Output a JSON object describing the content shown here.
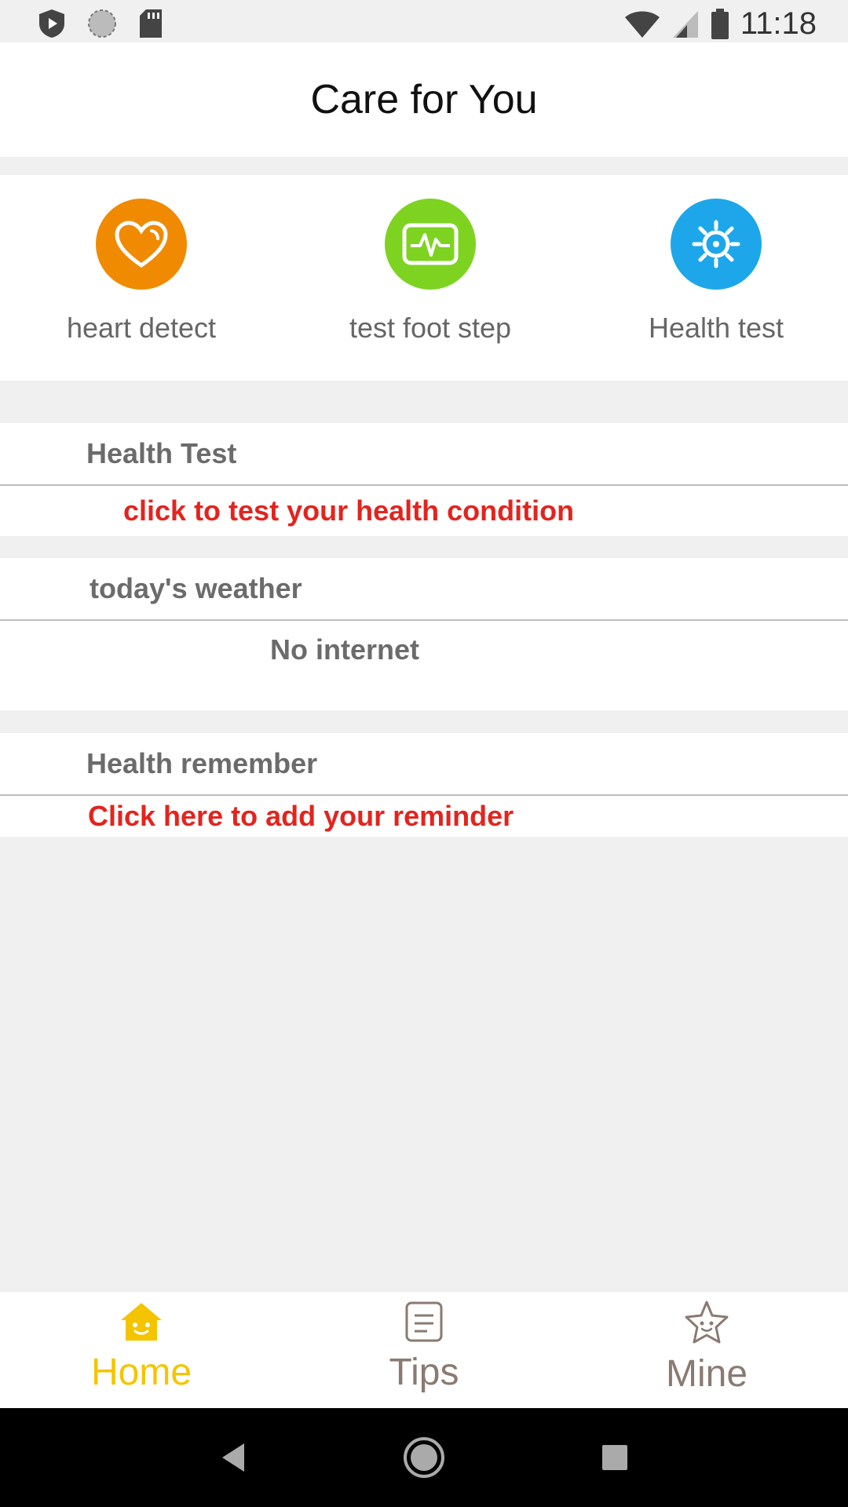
{
  "status_bar": {
    "time": "11:18",
    "icons": [
      "play-shield-icon",
      "sync-circle-icon",
      "sd-card-icon",
      "wifi-icon",
      "signal-icon",
      "battery-icon"
    ]
  },
  "title": "Care for You",
  "features": [
    {
      "label": "heart detect",
      "icon": "heart-icon",
      "color": "#f08a00"
    },
    {
      "label": "test foot step",
      "icon": "ecg-icon",
      "color": "#7ed321"
    },
    {
      "label": "Health test",
      "icon": "gear-icon",
      "color": "#1da7ea"
    }
  ],
  "sections": {
    "health_test": {
      "title": "Health Test",
      "action": "click to test your health condition"
    },
    "weather": {
      "title": "today's weather",
      "status": "No internet"
    },
    "health_remember": {
      "title": "Health remember",
      "action": "Click here to add your reminder"
    }
  },
  "bottom_nav": [
    {
      "label": "Home",
      "icon": "home-icon",
      "active": true,
      "color": "#f5c400"
    },
    {
      "label": "Tips",
      "icon": "tips-icon",
      "active": false,
      "color": "#8a7a72"
    },
    {
      "label": "Mine",
      "icon": "star-icon",
      "active": false,
      "color": "#8a7a72"
    }
  ],
  "system_nav": [
    "back-icon",
    "home-circle-icon",
    "recents-icon"
  ]
}
